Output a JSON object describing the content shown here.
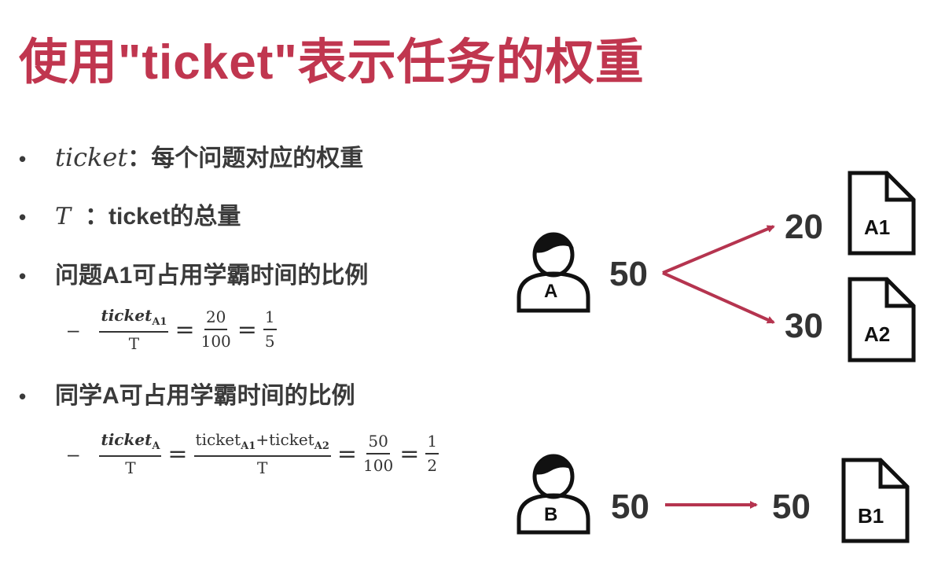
{
  "title": "使用\"ticket\"表示任务的权重",
  "bullets": {
    "b1_term": "ticket",
    "b1_text": "：每个问题对应的权重",
    "b2_term": "T",
    "b2_text": "：ticket的总量",
    "b3_text": "问题A1可占用学霸时间的比例",
    "b4_text": "同学A可占用学霸时间的比例"
  },
  "formula1": {
    "dash": "–",
    "num1": "ticket",
    "num1_sub": "A1",
    "den1": "T",
    "eq": "=",
    "num2": "20",
    "den2": "100",
    "num3": "1",
    "den3": "5"
  },
  "formula2": {
    "dash": "–",
    "num1": "ticket",
    "num1_sub": "A",
    "den1": "T",
    "eq": "=",
    "num2a": "ticket",
    "num2a_sub": "A1",
    "plus": "+",
    "num2b": "ticket",
    "num2b_sub": "A2",
    "den2": "T",
    "num3": "50",
    "den3": "100",
    "num4": "1",
    "den4": "2"
  },
  "diagram": {
    "person_a_label": "A",
    "person_a_value": "50",
    "task_a1_value": "20",
    "task_a1_label": "A1",
    "task_a2_value": "30",
    "task_a2_label": "A2",
    "person_b_label": "B",
    "person_b_value": "50",
    "task_b1_value": "50",
    "task_b1_label": "B1",
    "arrow_color": "#b5344f"
  }
}
